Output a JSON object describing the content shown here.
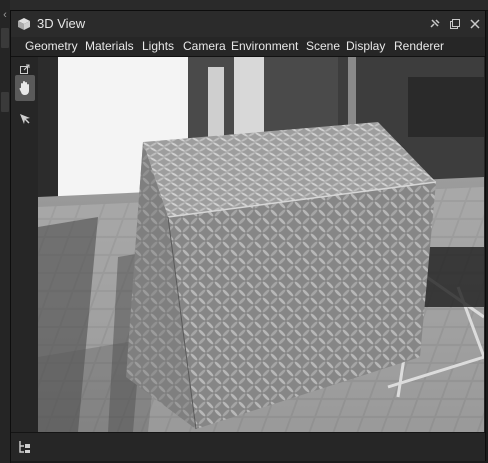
{
  "window": {
    "title": "3D View",
    "title_icon": "cube-icon",
    "buttons": [
      {
        "name": "pin-icon",
        "glyph": "✕"
      },
      {
        "name": "float-window-icon",
        "glyph": "⧉"
      },
      {
        "name": "close-icon",
        "glyph": "✕"
      }
    ]
  },
  "menubar": {
    "items": [
      {
        "label": "Geometry"
      },
      {
        "label": "Materials"
      },
      {
        "label": "Lights"
      },
      {
        "label": "Camera"
      },
      {
        "label": "Environment"
      },
      {
        "label": "Scene"
      },
      {
        "label": "Display"
      },
      {
        "label": "Renderer"
      }
    ]
  },
  "toolbar": {
    "tools": [
      {
        "name": "popout-icon",
        "glyph": "⇱",
        "active": false
      },
      {
        "name": "pan-hand-icon",
        "glyph": "✋",
        "active": true
      },
      {
        "name": "select-arrow-icon",
        "glyph": "➚",
        "active": false
      }
    ]
  },
  "viewport": {
    "content": "textured-cube-render",
    "material": "diamond plate metal"
  },
  "bottombar": {
    "icon": "scene-tree-icon",
    "glyph": "⊏"
  },
  "colors": {
    "panel_bg": "#262626",
    "title_bg": "#2b2b2b",
    "text": "#e8e8e8",
    "active_tool": "#5a5a5a"
  }
}
